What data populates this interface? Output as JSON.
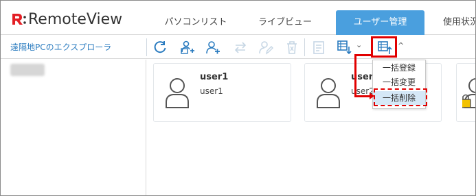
{
  "app": {
    "logo_text": "RemoteView",
    "brand_color": "#e31e24",
    "accent_color": "#4a9fde"
  },
  "tabs": [
    {
      "label": "パソコンリスト",
      "active": false
    },
    {
      "label": "ライブビュー",
      "active": false
    },
    {
      "label": "ユーザー管理",
      "active": true
    },
    {
      "label": "使用状況",
      "active": false
    }
  ],
  "toolbar": {
    "explorer_title": "遠隔地PCのエクスプローラ",
    "icons": [
      "refresh-icon",
      "add-group-icon",
      "add-user-icon",
      "swap-icon",
      "edit-user-icon",
      "delete-icon",
      "list-icon",
      "bulk-import-icon",
      "bulk-export-icon"
    ],
    "chevron": "⌄",
    "chevron_up": "^"
  },
  "cards": [
    {
      "title": "user1",
      "subtitle": "user1",
      "locked": false
    },
    {
      "title": "user2",
      "subtitle": "user2",
      "locked": false
    },
    {
      "title": "",
      "subtitle": "",
      "locked": true
    }
  ],
  "dropdown": {
    "items": [
      {
        "label": "一括登録",
        "highlighted": false
      },
      {
        "label": "一括変更",
        "highlighted": false
      },
      {
        "label": "一括削除",
        "highlighted": true
      }
    ]
  }
}
